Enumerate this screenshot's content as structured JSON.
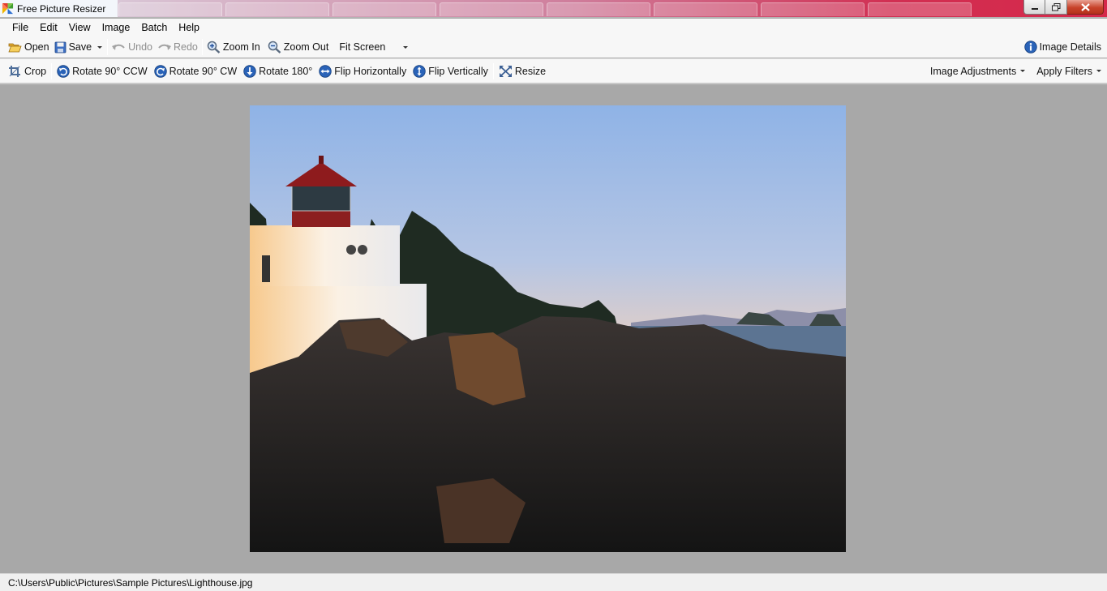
{
  "window": {
    "title": "Free Picture Resizer",
    "icon": "app-pinwheel-icon",
    "controls": [
      "minimize-icon",
      "restore-icon",
      "close-icon"
    ]
  },
  "menu": {
    "file": "File",
    "edit": "Edit",
    "view": "View",
    "image": "Image",
    "batch": "Batch",
    "help": "Help"
  },
  "toolbar_main": {
    "open": "Open",
    "save": "Save",
    "undo": "Undo",
    "redo": "Redo",
    "zoom_in": "Zoom In",
    "zoom_out": "Zoom Out",
    "zoom_mode": "Fit Screen",
    "image_details": "Image Details"
  },
  "toolbar_edit": {
    "crop": "Crop",
    "rotate_ccw": "Rotate 90° CCW",
    "rotate_cw": "Rotate 90° CW",
    "rotate_180": "Rotate 180°",
    "flip_h": "Flip Horizontally",
    "flip_v": "Flip Vertically",
    "resize": "Resize",
    "image_adjustments": "Image Adjustments",
    "apply_filters": "Apply Filters"
  },
  "colors": {
    "canvas_bg": "#a8a8a8",
    "toolbar_bg": "#f7f7f7",
    "icon_blue": "#2a63b8"
  },
  "status": {
    "file_path": "C:\\Users\\Public\\Pictures\\Sample Pictures\\Lighthouse.jpg"
  }
}
